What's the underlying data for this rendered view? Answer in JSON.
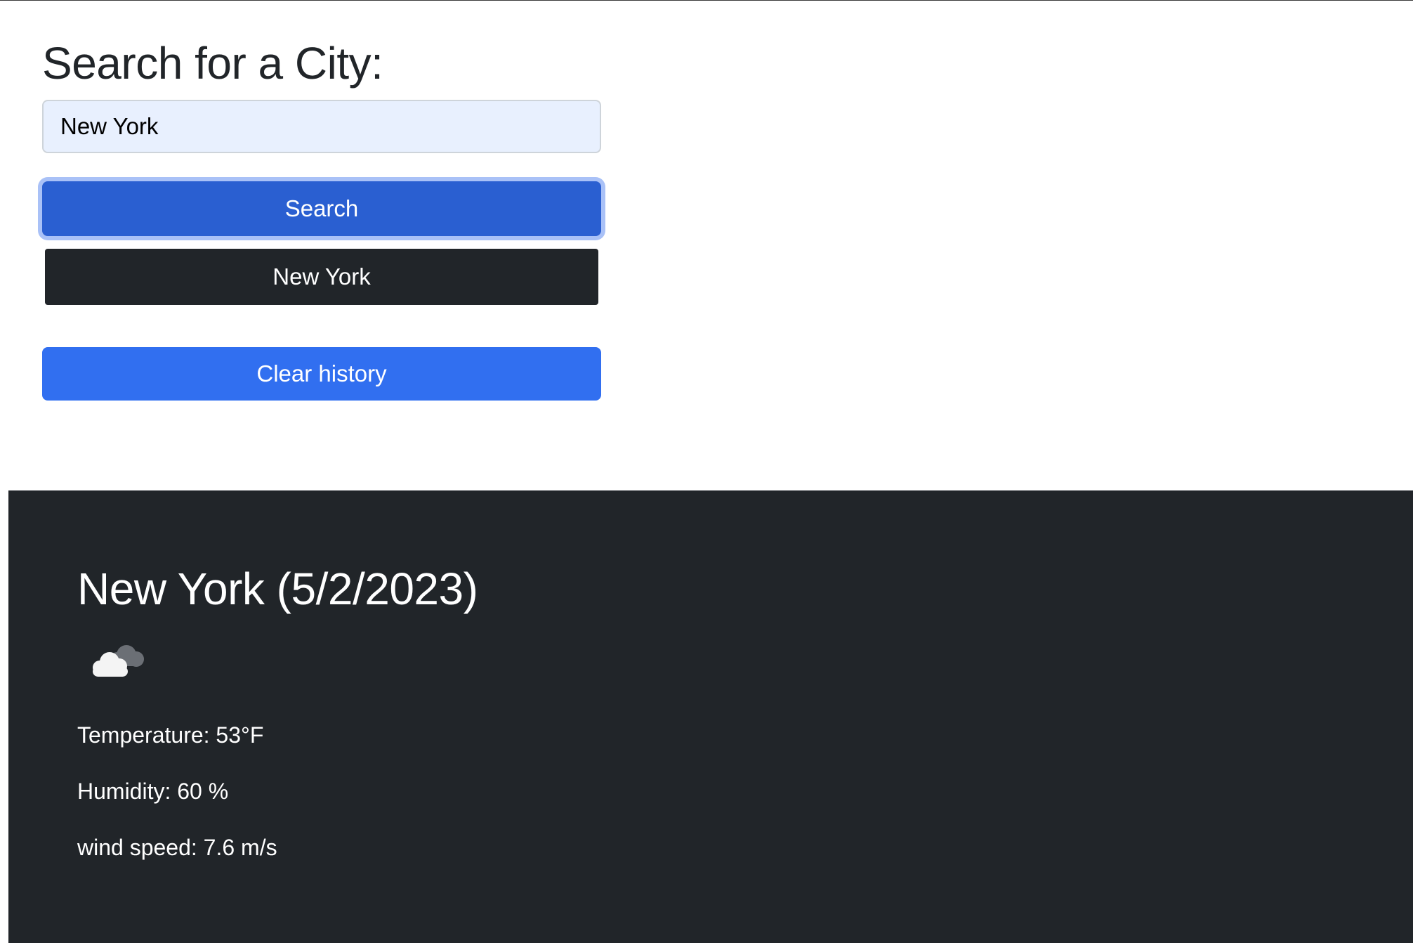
{
  "search": {
    "title": "Search for a City:",
    "input_value": "New York",
    "search_label": "Search",
    "history": [
      {
        "label": "New York"
      }
    ],
    "clear_label": "Clear history"
  },
  "weather": {
    "heading": "New York (5/2/2023)",
    "icon": "cloud-icon",
    "temperature": "Temperature: 53°F",
    "humidity": "Humidity: 60 %",
    "wind": "wind speed: 7.6 m/s"
  },
  "colors": {
    "search_button": "#2a5fd1",
    "history_button": "#212529",
    "clear_button": "#316ff0",
    "weather_panel": "#212529"
  }
}
